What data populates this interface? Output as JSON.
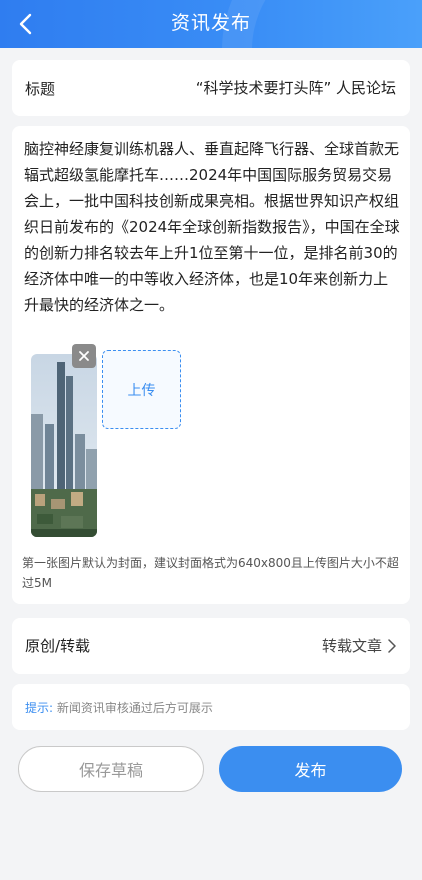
{
  "header": {
    "title": "资讯发布"
  },
  "form": {
    "title_label": "标题",
    "title_value": "“科学技术要打头阵” 人民论坛",
    "content": "脑控神经康复训练机器人、垂直起降飞行器、全球首款无辐式超级氢能摩托车……2024年中国国际服务贸易交易会上，一批中国科技创新成果亮相。根据世界知识产权组织日前发布的《2024年全球创新指数报告》，中国在全球的创新力排名较去年上升1位至第十一位，是排名前30的经济体中唯一的中等收入经济体，也是10年来创新力上升最快的经济体之一。",
    "upload_label": "上传",
    "image_hint": "第一张图片默认为封面，建议封面格式为640x800且上传图片大小不超过5M",
    "type_label": "原创/转载",
    "type_value": "转载文章",
    "tip_label": "提示:",
    "tip_text": "新闻资讯审核通过后方可展示"
  },
  "actions": {
    "save_draft": "保存草稿",
    "publish": "发布"
  },
  "colors": {
    "accent": "#3b8ef0",
    "header_start": "#2f7df0",
    "header_end": "#4aa0fa",
    "background": "#f3f4f6"
  },
  "icons": {
    "back": "chevron-left-icon",
    "remove": "close-icon",
    "arrow": "chevron-right-icon"
  }
}
